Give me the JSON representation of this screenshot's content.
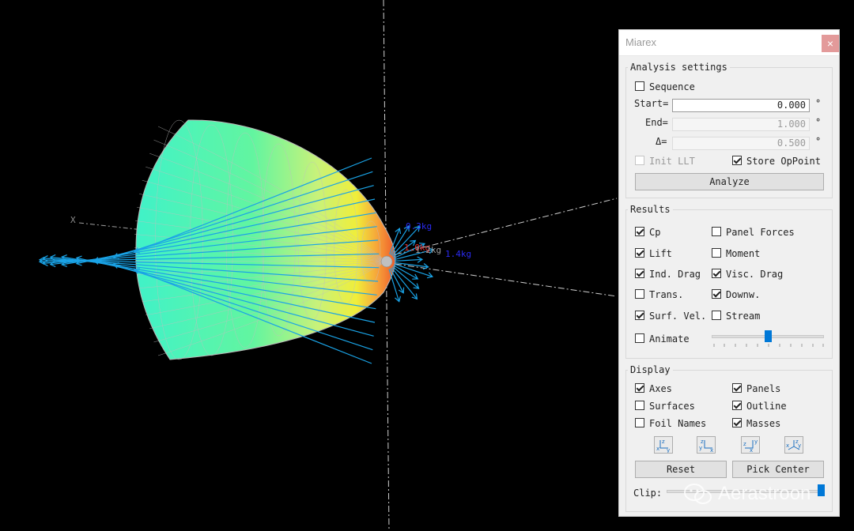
{
  "window": {
    "title": "Miarex",
    "close_label": "×"
  },
  "analysis": {
    "legend": "Analysis settings",
    "sequence": {
      "label": "Sequence",
      "checked": false
    },
    "start": {
      "label": "Start=",
      "value": "0.000",
      "unit": "°"
    },
    "end": {
      "label": "End=",
      "value": "1.000",
      "unit": "°"
    },
    "delta": {
      "label": "Δ=",
      "value": "0.500",
      "unit": "°"
    },
    "init_llt": {
      "label": "Init LLT",
      "checked": false,
      "enabled": false
    },
    "store_oppoint": {
      "label": "Store OpPoint",
      "checked": true
    },
    "analyze_label": "Analyze"
  },
  "results": {
    "legend": "Results",
    "cp": {
      "label": "Cp",
      "checked": true
    },
    "panel_forces": {
      "label": "Panel Forces",
      "checked": false
    },
    "lift": {
      "label": "Lift",
      "checked": true
    },
    "moment": {
      "label": "Moment",
      "checked": false
    },
    "ind_drag": {
      "label": "Ind. Drag",
      "checked": true
    },
    "visc_drag": {
      "label": "Visc. Drag",
      "checked": true
    },
    "trans": {
      "label": "Trans.",
      "checked": false
    },
    "downw": {
      "label": "Downw.",
      "checked": true
    },
    "surf_vel": {
      "label": "Surf. Vel.",
      "checked": true
    },
    "stream": {
      "label": "Stream",
      "checked": false
    },
    "animate": {
      "label": "Animate",
      "checked": false,
      "slider_fraction": 0.5
    }
  },
  "display": {
    "legend": "Display",
    "axes": {
      "label": "Axes",
      "checked": true
    },
    "panels": {
      "label": "Panels",
      "checked": true
    },
    "surfaces": {
      "label": "Surfaces",
      "checked": false
    },
    "outline": {
      "label": "Outline",
      "checked": true
    },
    "foil_names": {
      "label": "Foil Names",
      "checked": false
    },
    "masses": {
      "label": "Masses",
      "checked": true
    },
    "view_icons": [
      "view-xz-icon",
      "view-yx-icon",
      "view-zy-icon",
      "view-iso-icon"
    ],
    "reset_label": "Reset",
    "pick_center_label": "Pick Center",
    "clip_label": "Clip:",
    "clip_fraction": 1.0
  },
  "viewport": {
    "axis_label": "X",
    "mass_labels": [
      "0.3kg",
      "1.0kg",
      "1.2kg",
      "1.4kg"
    ],
    "surface_gradient": [
      "#40f2c8",
      "#62f5a0",
      "#c8f27a",
      "#f0ee3a",
      "#f6a43a",
      "#ef5a2a"
    ],
    "arrow_color": "#1aa3e6",
    "mesh_color": "#b9b9b9"
  },
  "watermark": {
    "text": "Aerastroon"
  }
}
